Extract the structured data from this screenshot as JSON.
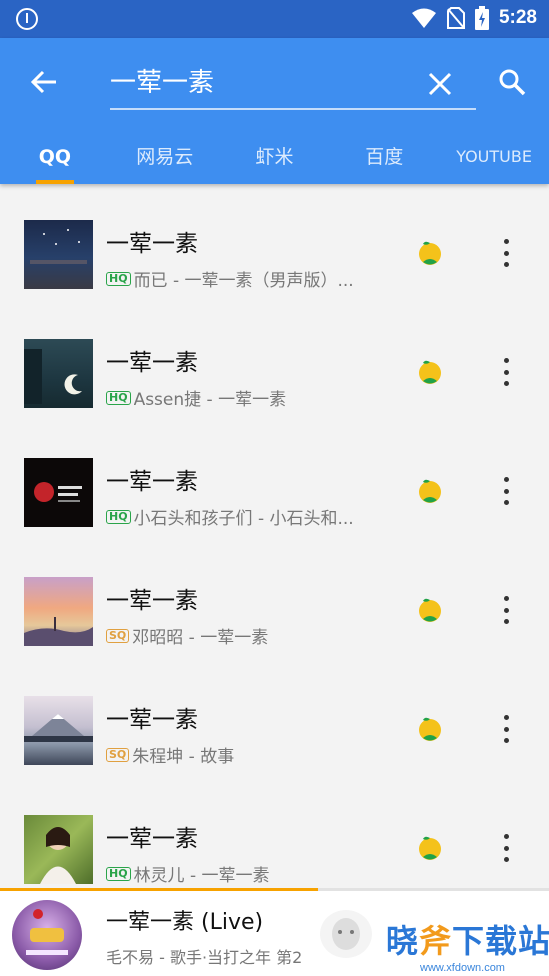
{
  "header": {
    "search_query": "一荤一素",
    "tabs": [
      {
        "label": "QQ",
        "active": true
      },
      {
        "label": "网易云",
        "active": false
      },
      {
        "label": "虾米",
        "active": false
      },
      {
        "label": "百度",
        "active": false
      },
      {
        "label": "YOUTUBE",
        "active": false
      }
    ]
  },
  "songs": [
    {
      "title": "一荤一素",
      "quality": "HQ",
      "subtitle": "而已 - 一荤一素（男声版）..."
    },
    {
      "title": "一荤一素",
      "quality": "HQ",
      "subtitle": "Assen捷 - 一荤一素"
    },
    {
      "title": "一荤一素",
      "quality": "HQ",
      "subtitle": "小石头和孩子们 - 小石头和..."
    },
    {
      "title": "一荤一素",
      "quality": "SQ",
      "subtitle": "邓昭昭 - 一荤一素"
    },
    {
      "title": "一荤一素",
      "quality": "SQ",
      "subtitle": "朱程坤 - 故事"
    },
    {
      "title": "一荤一素",
      "quality": "HQ",
      "subtitle": "林灵儿 - 一荤一素"
    }
  ],
  "player": {
    "title": "一荤一素 (Live)",
    "subtitle": "毛不易 - 歌手·当打之年 第2",
    "progress_fraction": 0.58
  },
  "watermark": {
    "text_a": "晓",
    "text_b": "斧",
    "text_c": "下载站",
    "sub": "www.xfdown.com"
  },
  "colors": {
    "appbar": "#3e8ef0",
    "statusbar": "#2a64c4",
    "accent": "#f7a200",
    "hq": "#2aa44a",
    "sq": "#e0a040"
  },
  "icons": {
    "source": "qq-music-icon",
    "more": "more-vert-icon",
    "back": "arrow-back-icon",
    "clear": "close-icon",
    "search": "search-icon"
  }
}
